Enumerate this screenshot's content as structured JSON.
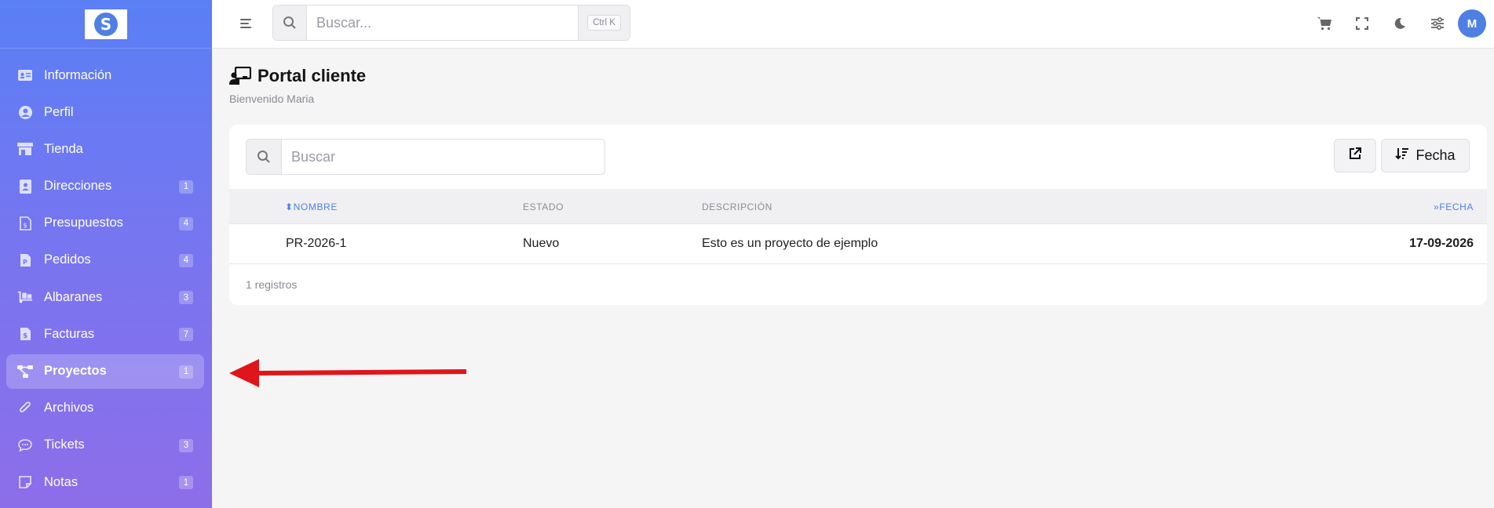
{
  "sidebar": {
    "logo_letter": "S",
    "items": [
      {
        "label": "Información",
        "icon": "id-card-icon",
        "badge": ""
      },
      {
        "label": "Perfil",
        "icon": "user-circle-icon",
        "badge": ""
      },
      {
        "label": "Tienda",
        "icon": "store-icon",
        "badge": ""
      },
      {
        "label": "Direcciones",
        "icon": "address-book-icon",
        "badge": "1"
      },
      {
        "label": "Presupuestos",
        "icon": "file-quote-icon",
        "badge": "4"
      },
      {
        "label": "Pedidos",
        "icon": "file-order-icon",
        "badge": "4"
      },
      {
        "label": "Albaranes",
        "icon": "dolly-icon",
        "badge": "3"
      },
      {
        "label": "Facturas",
        "icon": "invoice-icon",
        "badge": "7"
      },
      {
        "label": "Proyectos",
        "icon": "project-diagram-icon",
        "badge": "1",
        "active": true
      },
      {
        "label": "Archivos",
        "icon": "paperclip-icon",
        "badge": ""
      },
      {
        "label": "Tickets",
        "icon": "chat-icon",
        "badge": "3"
      },
      {
        "label": "Notas",
        "icon": "note-icon",
        "badge": "1"
      }
    ]
  },
  "topbar": {
    "search_placeholder": "Buscar...",
    "shortcut": "Ctrl K",
    "avatar_initial": "M"
  },
  "page": {
    "title": "Portal cliente",
    "subtitle": "Bienvenido Maria"
  },
  "card": {
    "search_placeholder": "Buscar",
    "sort_button_label": "Fecha",
    "columns": {
      "nombre": "NOMBRE",
      "estado": "ESTADO",
      "descripcion": "DESCRIPCIÓN",
      "fecha": "FECHA"
    },
    "rows": [
      {
        "nombre": "PR-2026-1",
        "estado": "Nuevo",
        "descripcion": "Esto es un proyecto de ejemplo",
        "fecha": "17-09-2026"
      }
    ],
    "records_text": "1 registros"
  },
  "colors": {
    "accent": "#4f7fe3",
    "sidebar_top": "#5a7ff5",
    "sidebar_bottom": "#8d6ee9",
    "annotation_arrow": "#e0151b"
  }
}
